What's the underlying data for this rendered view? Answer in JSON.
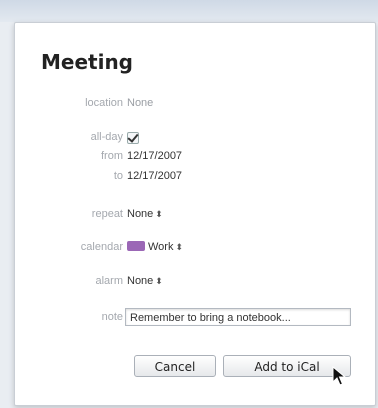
{
  "dialog": {
    "title": "Meeting",
    "fields": {
      "location": {
        "label": "location",
        "value": "None"
      },
      "all_day": {
        "label": "all-day",
        "checked": true
      },
      "from": {
        "label": "from",
        "value": "12/17/2007"
      },
      "to": {
        "label": "to",
        "value": "12/17/2007"
      },
      "repeat": {
        "label": "repeat",
        "value": "None"
      },
      "calendar": {
        "label": "calendar",
        "value": "Work",
        "color": "#9b67b6"
      },
      "alarm": {
        "label": "alarm",
        "value": "None"
      },
      "note": {
        "label": "note",
        "value": "Remember to bring a notebook..."
      }
    },
    "buttons": {
      "cancel": "Cancel",
      "add": "Add to iCal"
    },
    "icons": {
      "checkbox": "checkmark-icon",
      "popup": "up-down-arrows-icon",
      "cursor": "mouse-pointer-icon"
    }
  }
}
